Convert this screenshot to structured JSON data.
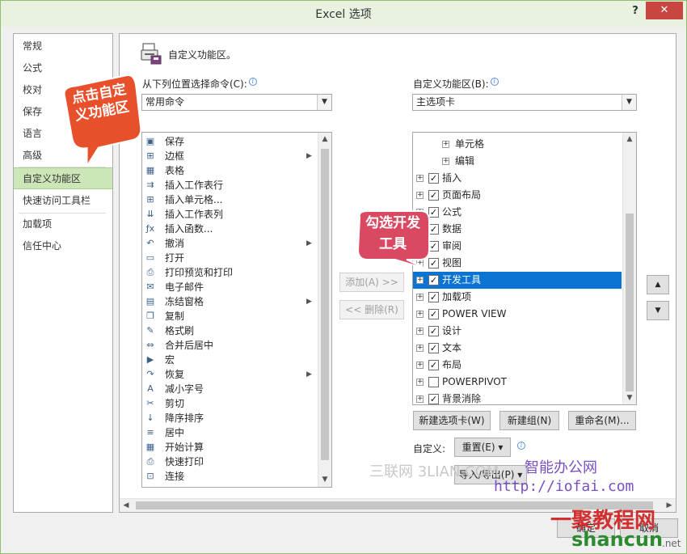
{
  "window": {
    "title": "Excel 选项",
    "help": "?",
    "close": "✕"
  },
  "nav": {
    "items": [
      {
        "label": "常规"
      },
      {
        "label": "公式"
      },
      {
        "label": "校对"
      },
      {
        "label": "保存"
      },
      {
        "label": "语言"
      },
      {
        "label": "高级"
      },
      {
        "label": "自定义功能区"
      },
      {
        "label": "快速访问工具栏"
      },
      {
        "label": "加载项"
      },
      {
        "label": "信任中心"
      }
    ],
    "active": "自定义功能区"
  },
  "header": {
    "title": "自定义功能区。"
  },
  "left_panel": {
    "label": "从下列位置选择命令(C):",
    "selected": "常用命令",
    "commands": [
      {
        "icon": "save-icon",
        "glyph": "▣",
        "label": "保存",
        "submenu": false
      },
      {
        "icon": "border-icon",
        "glyph": "⊞",
        "label": "边框",
        "submenu": true
      },
      {
        "icon": "table-icon",
        "glyph": "▦",
        "label": "表格",
        "submenu": false
      },
      {
        "icon": "insert-row-icon",
        "glyph": "⇉",
        "label": "插入工作表行",
        "submenu": false
      },
      {
        "icon": "insert-cell-icon",
        "glyph": "⊞",
        "label": "插入单元格...",
        "submenu": false
      },
      {
        "icon": "insert-column-icon",
        "glyph": "⇊",
        "label": "插入工作表列",
        "submenu": false
      },
      {
        "icon": "function-icon",
        "glyph": "ƒx",
        "label": "插入函数...",
        "submenu": false
      },
      {
        "icon": "undo-icon",
        "glyph": "↶",
        "label": "撤消",
        "submenu": true
      },
      {
        "icon": "open-icon",
        "glyph": "▭",
        "label": "打开",
        "submenu": false
      },
      {
        "icon": "print-preview-icon",
        "glyph": "⎙",
        "label": "打印预览和打印",
        "submenu": false
      },
      {
        "icon": "email-icon",
        "glyph": "✉",
        "label": "电子邮件",
        "submenu": false
      },
      {
        "icon": "freeze-panes-icon",
        "glyph": "▤",
        "label": "冻结窗格",
        "submenu": true
      },
      {
        "icon": "copy-icon",
        "glyph": "❐",
        "label": "复制",
        "submenu": false
      },
      {
        "icon": "format-painter-icon",
        "glyph": "✎",
        "label": "格式刷",
        "submenu": false
      },
      {
        "icon": "merge-center-icon",
        "glyph": "⇔",
        "label": "合并后居中",
        "submenu": false
      },
      {
        "icon": "macro-icon",
        "glyph": "▶",
        "label": "宏",
        "submenu": false
      },
      {
        "icon": "redo-icon",
        "glyph": "↷",
        "label": "恢复",
        "submenu": true
      },
      {
        "icon": "decrease-font-icon",
        "glyph": "A",
        "label": "减小字号",
        "submenu": false
      },
      {
        "icon": "cut-icon",
        "glyph": "✂",
        "label": "剪切",
        "submenu": false
      },
      {
        "icon": "sort-desc-icon",
        "glyph": "↓",
        "label": "降序排序",
        "submenu": false
      },
      {
        "icon": "align-center-icon",
        "glyph": "≡",
        "label": "居中",
        "submenu": false
      },
      {
        "icon": "calculate-icon",
        "glyph": "▦",
        "label": "开始计算",
        "submenu": false
      },
      {
        "icon": "quick-print-icon",
        "glyph": "⎙",
        "label": "快速打印",
        "submenu": false
      },
      {
        "icon": "connection-icon",
        "glyph": "⊡",
        "label": "连接",
        "submenu": false
      }
    ]
  },
  "middle": {
    "add": "添加(A) >>",
    "remove": "<< 删除(R)"
  },
  "right_panel": {
    "label": "自定义功能区(B):",
    "selected": "主选项卡",
    "tree": [
      {
        "level": 2,
        "label": "单元格",
        "checked": null,
        "selected": false
      },
      {
        "level": 2,
        "label": "编辑",
        "checked": null,
        "selected": false
      },
      {
        "level": 1,
        "label": "插入",
        "checked": true,
        "selected": false
      },
      {
        "level": 1,
        "label": "页面布局",
        "checked": true,
        "selected": false
      },
      {
        "level": 1,
        "label": "公式",
        "checked": true,
        "selected": false
      },
      {
        "level": 1,
        "label": "数据",
        "checked": true,
        "selected": false
      },
      {
        "level": 1,
        "label": "审阅",
        "checked": true,
        "selected": false
      },
      {
        "level": 1,
        "label": "视图",
        "checked": true,
        "selected": false
      },
      {
        "level": 1,
        "label": "开发工具",
        "checked": true,
        "selected": true
      },
      {
        "level": 1,
        "label": "加载项",
        "checked": true,
        "selected": false
      },
      {
        "level": 1,
        "label": "POWER VIEW",
        "checked": true,
        "selected": false
      },
      {
        "level": 1,
        "label": "设计",
        "checked": true,
        "selected": false
      },
      {
        "level": 1,
        "label": "文本",
        "checked": true,
        "selected": false
      },
      {
        "level": 1,
        "label": "布局",
        "checked": true,
        "selected": false
      },
      {
        "level": 1,
        "label": "POWERPIVOT",
        "checked": false,
        "selected": false
      },
      {
        "level": 1,
        "label": "背景消除",
        "checked": true,
        "selected": false
      }
    ],
    "new_tab": "新建选项卡(W)",
    "new_group": "新建组(N)",
    "rename": "重命名(M)...",
    "customize_label": "自定义:",
    "reset": "重置(E) ▾",
    "import_export": "导入/导出(P) ▾",
    "up": "▲",
    "down": "▼"
  },
  "footer": {
    "ok": "确定",
    "cancel": "取消"
  },
  "annotations": {
    "callout1": "点击自定义功能区",
    "callout2": "勾选开发工具"
  },
  "watermarks": {
    "sanlian": "三联网 3LIAN.COM",
    "brand": "智能办公网",
    "url": "http://iofai.com",
    "logo": "一聚教程网",
    "logo_sub": "shancun",
    "logo_net": ".net"
  },
  "colors": {
    "accent_nav": "#cde6b8",
    "selection": "#0b73d2",
    "callout1": "#e8502c",
    "callout2": "#d94a62",
    "close": "#c7463f"
  }
}
